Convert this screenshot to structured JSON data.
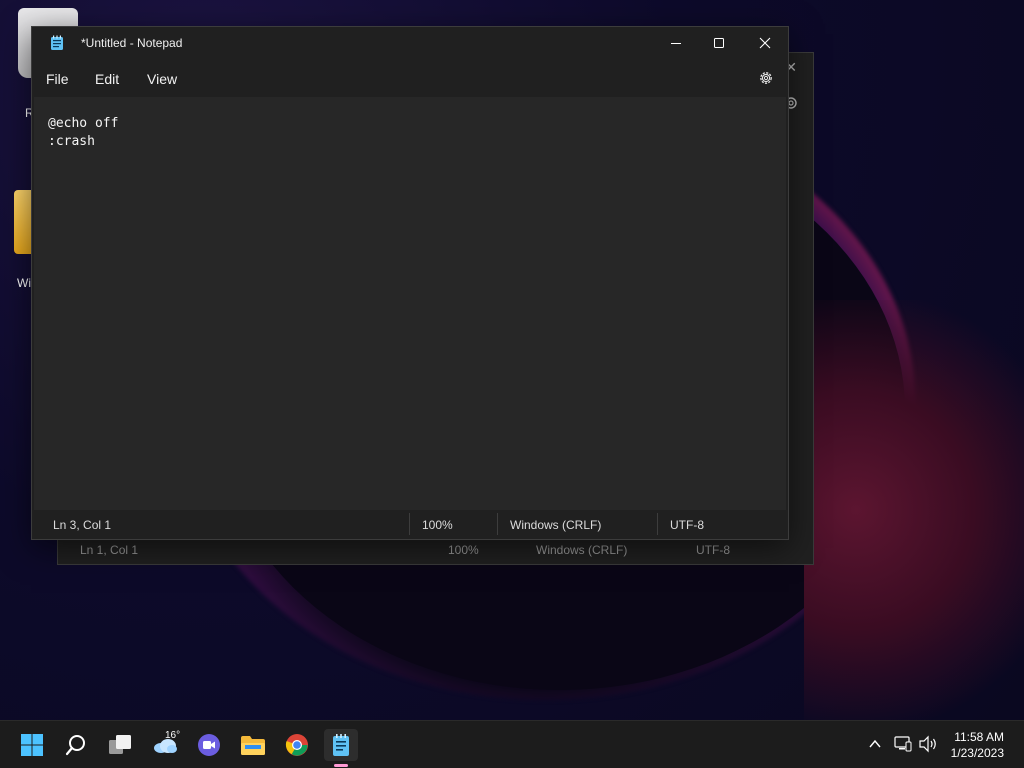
{
  "desktop": {
    "icons": [
      {
        "label": "R"
      },
      {
        "label": "Wi"
      }
    ]
  },
  "back_window": {
    "status": {
      "position": "Ln 1, Col 1",
      "zoom": "100%",
      "line_ending": "Windows (CRLF)",
      "encoding": "UTF-8"
    }
  },
  "window": {
    "title": "*Untitled - Notepad",
    "menu": {
      "file": "File",
      "edit": "Edit",
      "view": "View"
    },
    "content": {
      "lines": [
        "@echo off",
        ":crash"
      ]
    },
    "status": {
      "position": "Ln 3, Col 1",
      "zoom": "100%",
      "line_ending": "Windows (CRLF)",
      "encoding": "UTF-8"
    }
  },
  "taskbar": {
    "weather_temp": "16°",
    "clock": {
      "time": "11:58 AM",
      "date": "1/23/2023"
    }
  },
  "colors": {
    "accent_indicator": "#ff9ad5",
    "window_bg": "#202020",
    "editor_bg": "#272727"
  }
}
